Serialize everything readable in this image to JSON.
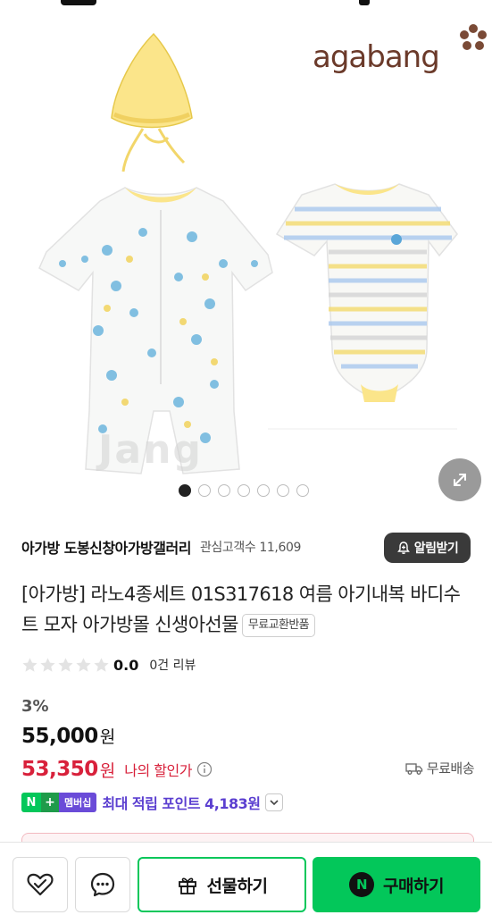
{
  "brand": {
    "logo_text": "agabang",
    "watermark": "Jang"
  },
  "gallery": {
    "slide_count": 7,
    "active_index": 0
  },
  "seller": {
    "store_name": "아가방 도봉신창아가방갤러리",
    "interest_label": "관심고객수 11,609",
    "alarm_label": "알림받기"
  },
  "product": {
    "title": "[아가방] 라노4종세트 01S317618 여름 아기내복 바디수트 모자 아가방몰 신생아선물",
    "free_exchange_badge": "무료교환반품",
    "rating": {
      "score": "0.0",
      "stars_filled": 0,
      "stars_total": 5,
      "review_label": "0건 리뷰"
    }
  },
  "price": {
    "discount": "3%",
    "original": "55,000",
    "original_unit": "원",
    "sale": "53,350",
    "sale_unit": "원",
    "my_discount_label": "나의 할인가",
    "shipping_label": "무료배송"
  },
  "points": {
    "n_label": "N",
    "plus_label": "+",
    "membership_label": "멤버십",
    "text": "최대 적립 포인트 4,183원"
  },
  "bottom": {
    "gift_label": "선물하기",
    "buy_label": "구매하기",
    "npay_letter": "N"
  },
  "colors": {
    "accent_green": "#03c75a",
    "sale_red": "#d8213b",
    "points_purple": "#5b3fd0"
  }
}
